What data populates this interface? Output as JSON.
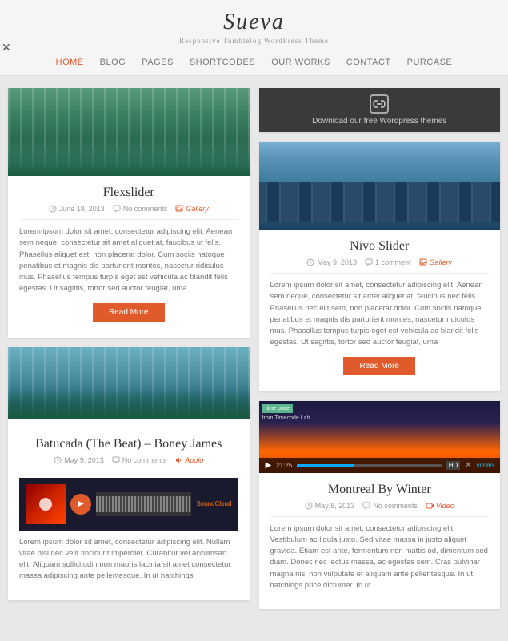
{
  "header": {
    "logo": "Sueva",
    "subtitle": "Responsive Tumblelog WordPress Theme",
    "nav": [
      {
        "label": "HOME",
        "active": true
      },
      {
        "label": "BLOG",
        "active": false
      },
      {
        "label": "PAGES",
        "active": false
      },
      {
        "label": "SHORTCODES",
        "active": false
      },
      {
        "label": "OUR WORKS",
        "active": false
      },
      {
        "label": "CONTACT",
        "active": false
      },
      {
        "label": "PURCASE",
        "active": false
      }
    ]
  },
  "posts": {
    "flexslider": {
      "title": "Flexslider",
      "date": "June 18, 2013",
      "comments": "No comments",
      "tag": "Gallery",
      "body": "Lorem ipsum dolor sit amet, consectetur adipiscing elit. Aenean sem neque, consectetur sit amet aliquet at, faucibus ut felis. Phasellus aliquet est, non placerat dolor. Cum sociis natoque penatibus et magnis dis parturient montes, nascetur ridiculus mus. Phasellus tempus turpis eget est vehicula ac blandit felis egestas. Ut sagittis, tortor sed auctor feugiat, uma",
      "read_more": "Read More"
    },
    "batucada": {
      "title": "Batucada (The Beat) – Boney James",
      "date": "May 9, 2013",
      "comments": "No comments",
      "tag": "Audio",
      "body": "Lorem ipsum dolor sit amet, consectetur adipiscing elit. Nullam vitae nisl nec velit tincidunt imperdiet. Curabitur vel accumsan elit. Aliquam sollicitudin non mauris lacinia sit amet consectetur massa adipiscing ante pellentesque. In ut hatchings"
    },
    "nivo": {
      "title": "Nivo Slider",
      "date": "May 9, 2013",
      "comments": "1 comment",
      "tag": "Gallery",
      "body": "Lorem ipsum dolor sit amet, consectetur adipiscing elit. Aenean sem neque, consectetur sit amet aliquet at, faucibus nec felis. Phasellus nec elit sem, non placerat dolor. Cum sociis natoque penatibus et magnis dis parturient montes, nascetur ridiculus mus. Phasellus tempus turpis eget est vehicula ac blandit felis egestas. Ut sagittis, tortor sed auctor feugiat, uma",
      "read_more": "Read More"
    },
    "montreal": {
      "title": "Montreal By Winter",
      "date": "May 8, 2013",
      "comments": "No comments",
      "tag": "Video",
      "body": "Lorem ipsum dolor sit amet, consectetur adipiscing elit. Vestibulum ac ligula justo. Sed vitae massa in justo aliquet gravida. Etiam est ante, fermentum non mattis od, dimentum sed diam. Donec nec lectus massa, ac egestas sem. Cras pulvinar magna nisi non vulputate et aliquam ante pellentesque. In ut hatchings price dictumer. In ut",
      "video_overlay": "time code",
      "video_from": "from Timecode Lab",
      "video_time": "21:25"
    },
    "download": {
      "text": "Download our free Wordpress themes"
    }
  }
}
